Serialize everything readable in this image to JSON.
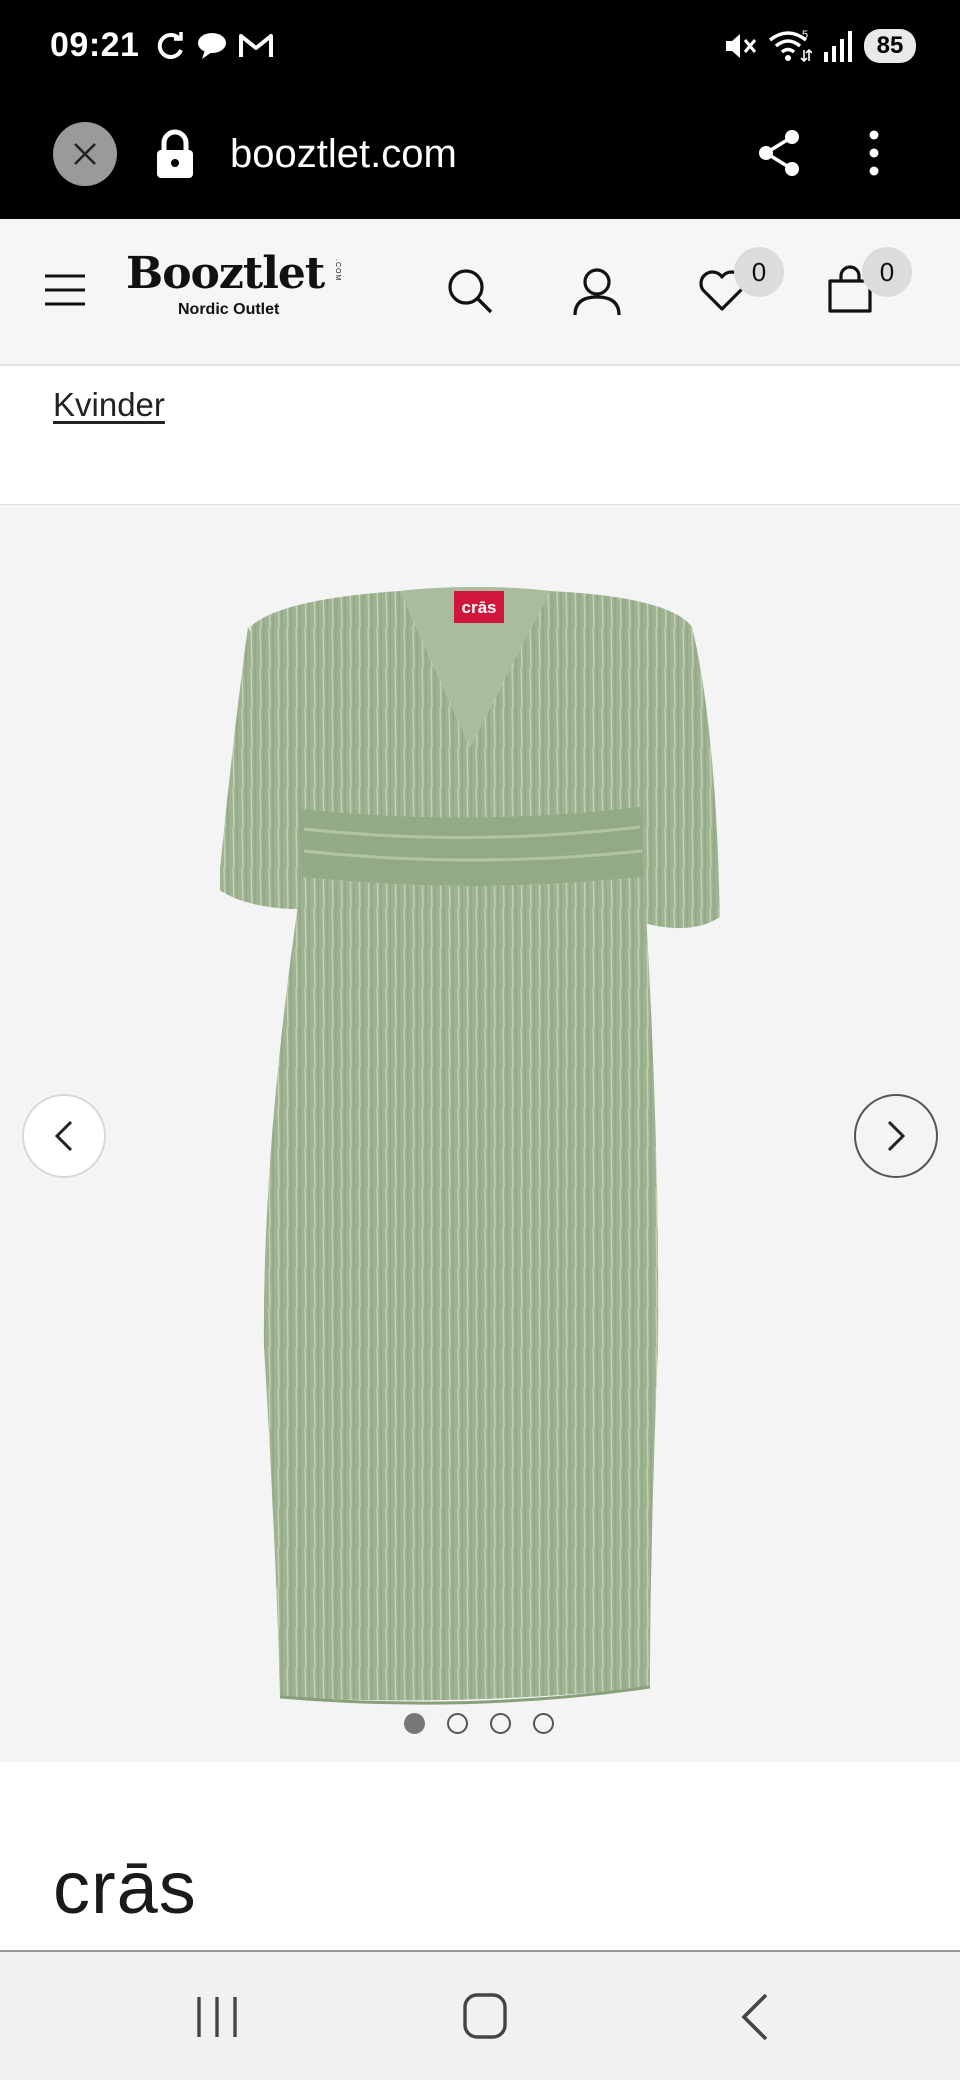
{
  "status_bar": {
    "time": "09:21",
    "battery": "85",
    "icons": [
      "sync-icon",
      "chat-bubble-icon",
      "gmail-icon",
      "mute-icon",
      "wifi-icon",
      "signal-icon"
    ]
  },
  "browser": {
    "url": "booztlet.com"
  },
  "header": {
    "logo_main": "Booztlet",
    "logo_dotcom": ".COM",
    "logo_sub": "Nordic Outlet",
    "wishlist_count": "0",
    "cart_count": "0"
  },
  "breadcrumb": {
    "label": "Kvinder"
  },
  "gallery": {
    "label_tag": "crās",
    "image_count": 4,
    "active_index": 0,
    "dress_color": "#9fb393"
  },
  "brand": {
    "name": "crās"
  },
  "colors": {
    "background": "#ffffff",
    "header_bg": "#f6f6f6",
    "gallery_bg": "#f4f4f4",
    "label_red": "#d0163a"
  }
}
